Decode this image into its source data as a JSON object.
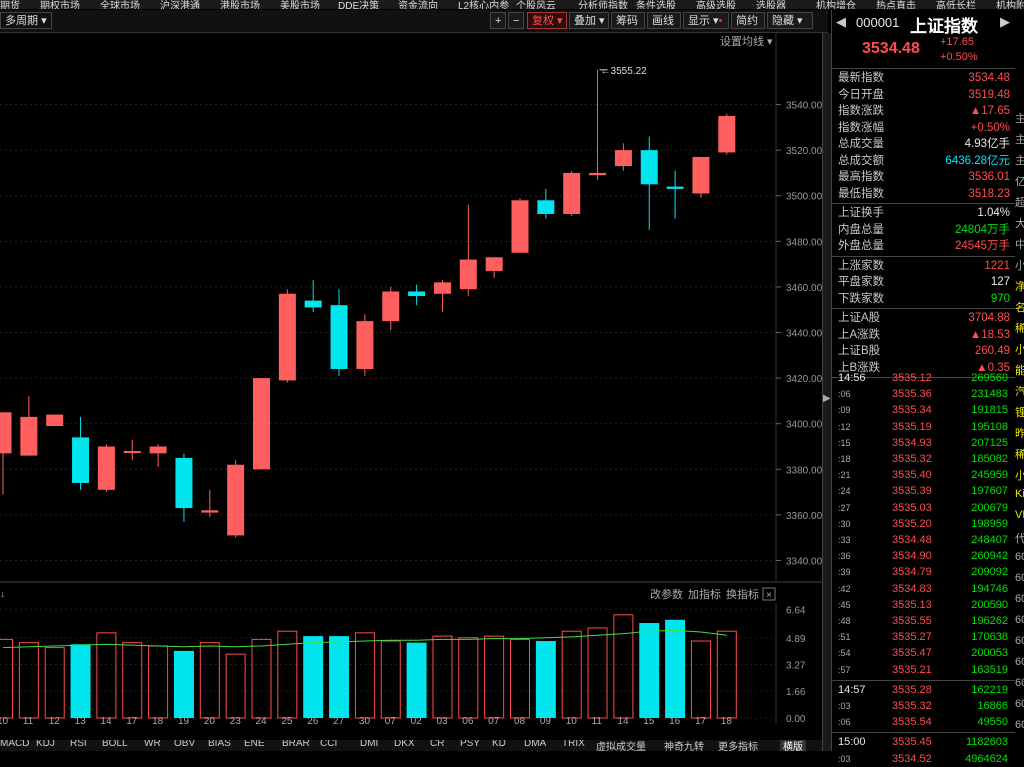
{
  "top_menu": [
    "期货",
    "期权市场",
    "全球市场",
    "沪深港通",
    "港股市场",
    "美股市场",
    "DDE决策",
    "资金流向",
    "L2核心内参",
    "个股风云",
    "分析师指数",
    "条件选股",
    "高级选股",
    "选股器",
    "机构增仓",
    "热点直击",
    "高低长栏",
    "机构附"
  ],
  "toolbar": {
    "period": "多周期",
    "plus": "+",
    "minus": "−",
    "fuquan": "复权",
    "overlay": "叠加",
    "chips": "筹码",
    "draw": "画线",
    "display": "显示",
    "simple": "简约",
    "hide": "隐藏"
  },
  "chart": {
    "settings_label": "设置均线",
    "high_annotation": "3555.22",
    "ma_hint": "设置均线",
    "vol_buttons": [
      "改参数",
      "加指标",
      "换指标"
    ],
    "vol_close": "×"
  },
  "chart_data": {
    "type": "candlestick",
    "y_ticks": [
      3540.0,
      3520.0,
      3500.0,
      3480.0,
      3460.0,
      3440.0,
      3420.0,
      3400.0,
      3380.0,
      3360.0,
      3340.0
    ],
    "ylim": [
      3331,
      3567
    ],
    "x_labels": [
      "10",
      "11",
      "12",
      "13",
      "14",
      "17",
      "18",
      "19",
      "20",
      "23",
      "24",
      "25",
      "26",
      "27",
      "30",
      "07",
      "02",
      "03",
      "06",
      "07",
      "08",
      "09",
      "10",
      "11",
      "14",
      "15",
      "16",
      "17",
      "18"
    ],
    "candles": [
      {
        "o": 3387,
        "h": 3404,
        "l": 3369,
        "c": 3405
      },
      {
        "o": 3386,
        "h": 3412,
        "l": 3386,
        "c": 3403
      },
      {
        "o": 3399,
        "h": 3404,
        "l": 3399,
        "c": 3404
      },
      {
        "o": 3394,
        "h": 3403,
        "l": 3371,
        "c": 3374
      },
      {
        "o": 3371,
        "h": 3391,
        "l": 3370,
        "c": 3390
      },
      {
        "o": 3388,
        "h": 3393,
        "l": 3384,
        "c": 3388
      },
      {
        "o": 3387,
        "h": 3391,
        "l": 3381,
        "c": 3390
      },
      {
        "o": 3385,
        "h": 3387,
        "l": 3357,
        "c": 3363
      },
      {
        "o": 3361,
        "h": 3371,
        "l": 3359,
        "c": 3362
      },
      {
        "o": 3351,
        "h": 3384,
        "l": 3350,
        "c": 3382
      },
      {
        "o": 3380,
        "h": 3420,
        "l": 3380,
        "c": 3420
      },
      {
        "o": 3419,
        "h": 3459,
        "l": 3418,
        "c": 3457
      },
      {
        "o": 3454,
        "h": 3463,
        "l": 3449,
        "c": 3451
      },
      {
        "o": 3452,
        "h": 3459,
        "l": 3421,
        "c": 3424
      },
      {
        "o": 3424,
        "h": 3448,
        "l": 3421,
        "c": 3445
      },
      {
        "o": 3445,
        "h": 3460,
        "l": 3441,
        "c": 3458
      },
      {
        "o": 3458,
        "h": 3461,
        "l": 3452,
        "c": 3456
      },
      {
        "o": 3457,
        "h": 3463,
        "l": 3449,
        "c": 3462
      },
      {
        "o": 3459,
        "h": 3496,
        "l": 3456,
        "c": 3472
      },
      {
        "o": 3467,
        "h": 3473,
        "l": 3464,
        "c": 3473
      },
      {
        "o": 3475,
        "h": 3499,
        "l": 3475,
        "c": 3498
      },
      {
        "o": 3498,
        "h": 3503,
        "l": 3490,
        "c": 3492
      },
      {
        "o": 3492,
        "h": 3511,
        "l": 3491,
        "c": 3510
      },
      {
        "o": 3509,
        "h": 3555.22,
        "l": 3507,
        "c": 3510
      },
      {
        "o": 3513,
        "h": 3523,
        "l": 3511,
        "c": 3520
      },
      {
        "o": 3520,
        "h": 3526,
        "l": 3485,
        "c": 3505
      },
      {
        "o": 3504,
        "h": 3511,
        "l": 3490,
        "c": 3503
      },
      {
        "o": 3501,
        "h": 3517,
        "l": 3499,
        "c": 3517
      },
      {
        "o": 3519,
        "h": 3536,
        "l": 3518,
        "c": 3535
      }
    ],
    "vol_ticks": [
      "6.64",
      "4.89",
      "3.27",
      "1.66",
      "0.00"
    ],
    "vol_ylim": [
      0,
      6.9
    ],
    "volumes": [
      4.8,
      4.6,
      4.3,
      4.5,
      5.2,
      4.6,
      4.4,
      4.1,
      4.6,
      3.9,
      4.8,
      5.3,
      5.0,
      5.0,
      5.2,
      4.7,
      4.6,
      5.0,
      4.9,
      5.0,
      4.8,
      4.7,
      5.3,
      5.5,
      6.3,
      5.8,
      6.0,
      4.7,
      5.3
    ],
    "vol_ma": [
      4.3,
      4.35,
      4.4,
      4.45,
      4.5,
      4.45,
      4.4,
      4.35,
      4.4,
      4.35,
      4.4,
      4.5,
      4.6,
      4.65,
      4.7,
      4.75,
      4.75,
      4.8,
      4.8,
      4.85,
      4.85,
      4.9,
      4.95,
      5.05,
      5.15,
      5.3,
      5.35,
      5.25,
      5.05
    ]
  },
  "bottom_tabs": [
    "MACD",
    "KDJ",
    "RSI",
    "BOLL",
    "WR",
    "OBV",
    "BIAS",
    "ENE",
    "BRAR",
    "CCI",
    "DMI",
    "DKX",
    "CR",
    "PSY",
    "KD",
    "DMA",
    "TRIX",
    "虚拟成交量",
    "神奇九转",
    "更多指标",
    "横版"
  ],
  "quote": {
    "code": "000001",
    "name": "上证指数",
    "price": "3534.48",
    "change": "+17.65",
    "change_pct": "+0.50%",
    "rows": [
      {
        "label": "最新指数",
        "value": "3534.48",
        "color": "#ff4d4d"
      },
      {
        "label": "今日开盘",
        "value": "3519.48",
        "color": "#ff4d4d"
      },
      {
        "label": "指数涨跌",
        "value": "▲17.65",
        "color": "#ff4d4d"
      },
      {
        "label": "指数涨幅",
        "value": "+0.50%",
        "color": "#ff4d4d"
      },
      {
        "label": "总成交量",
        "value": "4.93亿手",
        "color": "#e8e8e8"
      },
      {
        "label": "总成交额",
        "value": "6436.28亿元",
        "color": "#00e5ff"
      },
      {
        "label": "最高指数",
        "value": "3536.01",
        "color": "#ff4d4d"
      },
      {
        "label": "最低指数",
        "value": "3518.23",
        "color": "#ff4d4d"
      }
    ],
    "rows2": [
      {
        "label": "上证换手",
        "value": "1.04%",
        "color": "#e8e8e8"
      },
      {
        "label": "内盘总量",
        "value": "24804万手",
        "color": "#00e000"
      },
      {
        "label": "外盘总量",
        "value": "24545万手",
        "color": "#ff4d4d"
      }
    ],
    "rows3": [
      {
        "label": "上涨家数",
        "value": "1221",
        "color": "#ff4d4d"
      },
      {
        "label": "平盘家数",
        "value": "127",
        "color": "#e8e8e8"
      },
      {
        "label": "下跌家数",
        "value": "970",
        "color": "#00e000"
      }
    ],
    "rows4": [
      {
        "label": "上证A股",
        "value": "3704.88",
        "color": "#ff4d4d"
      },
      {
        "label": "上A涨跌",
        "value": "▲18.53",
        "color": "#ff4d4d"
      },
      {
        "label": "上证B股",
        "value": "260.49",
        "color": "#ff4d4d"
      },
      {
        "label": "上B涨跌",
        "value": "▲0.35",
        "color": "#ff4d4d"
      }
    ]
  },
  "ticks": [
    {
      "t": "14:56",
      "p": "3535.12",
      "v": "269560"
    },
    {
      "t": ":06",
      "p": "3535.36",
      "v": "231483"
    },
    {
      "t": ":09",
      "p": "3535.34",
      "v": "191815"
    },
    {
      "t": ":12",
      "p": "3535.19",
      "v": "195108"
    },
    {
      "t": ":15",
      "p": "3534.93",
      "v": "207125"
    },
    {
      "t": ":18",
      "p": "3535.32",
      "v": "185082"
    },
    {
      "t": ":21",
      "p": "3535.40",
      "v": "245959"
    },
    {
      "t": ":24",
      "p": "3535.39",
      "v": "197607"
    },
    {
      "t": ":27",
      "p": "3535.03",
      "v": "200679"
    },
    {
      "t": ":30",
      "p": "3535.20",
      "v": "198959"
    },
    {
      "t": ":33",
      "p": "3534.48",
      "v": "248407"
    },
    {
      "t": ":36",
      "p": "3534.90",
      "v": "260942"
    },
    {
      "t": ":39",
      "p": "3534.79",
      "v": "209092"
    },
    {
      "t": ":42",
      "p": "3534.83",
      "v": "194746"
    },
    {
      "t": ":45",
      "p": "3535.13",
      "v": "200590"
    },
    {
      "t": ":48",
      "p": "3535.55",
      "v": "196262"
    },
    {
      "t": ":51",
      "p": "3535.27",
      "v": "170638"
    },
    {
      "t": ":54",
      "p": "3535.47",
      "v": "200053"
    },
    {
      "t": ":57",
      "p": "3535.21",
      "v": "163519"
    },
    {
      "t": "14:57",
      "p": "3535.28",
      "v": "162219"
    },
    {
      "t": ":03",
      "p": "3535.32",
      "v": "16866"
    },
    {
      "t": ":06",
      "p": "3535.54",
      "v": "49550"
    },
    {
      "t": "15:00",
      "p": "3535.45",
      "v": "1182603"
    },
    {
      "t": ":03",
      "p": "3534.52",
      "v": "4964624"
    }
  ],
  "far_strip": [
    "主",
    "主",
    "主",
    "亿",
    "超",
    "大",
    "中",
    "小",
    "净",
    "名",
    "稀",
    "小",
    "能",
    "汽",
    "锂",
    "昨",
    "稀",
    "小",
    "Ki",
    "VF",
    "代",
    "60",
    "60",
    "60",
    "60",
    "60",
    "60",
    "60",
    "60",
    "60"
  ]
}
